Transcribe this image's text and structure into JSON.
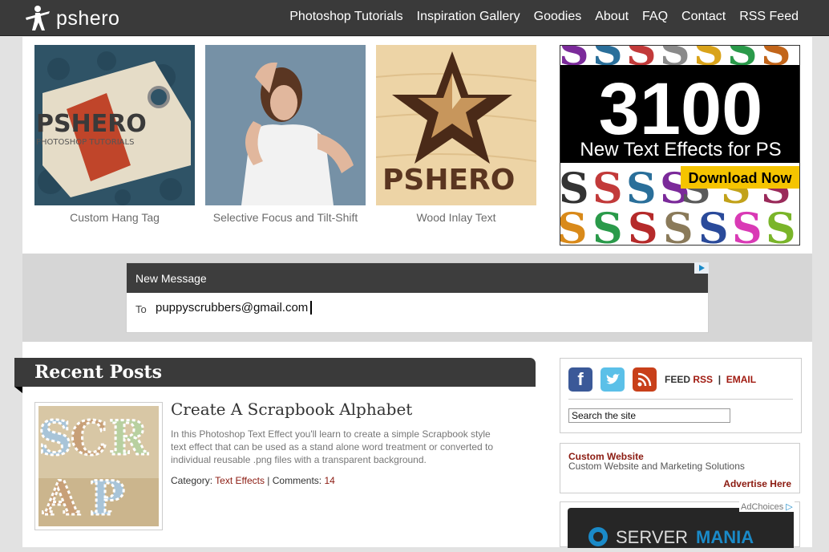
{
  "header": {
    "logo_text": "pshero",
    "nav": [
      "Photoshop Tutorials",
      "Inspiration Gallery",
      "Goodies",
      "About",
      "FAQ",
      "Contact",
      "RSS Feed"
    ]
  },
  "featured": [
    {
      "caption": "Custom Hang Tag",
      "art_text": "PSHERO",
      "art_sub": "PHOTOSHOP TUTORIALS"
    },
    {
      "caption": "Selective Focus and Tilt-Shift"
    },
    {
      "caption": "Wood Inlay Text",
      "art_text": "PSHERO"
    }
  ],
  "ad_right": {
    "big_number": "3100",
    "subline": "New Text Effects for PS",
    "cta": "Download Now"
  },
  "message": {
    "header": "New Message",
    "to_label": "To",
    "to_value": "puppyscrubbers@gmail.com"
  },
  "recent": {
    "heading": "Recent Posts",
    "post": {
      "title": "Create A Scrapbook Alphabet",
      "excerpt": "In this Photoshop Text Effect you'll learn to create a simple Scrapbook style text effect that can be used as a stand alone word treatment or converted to individual reusable .png files with a transparent background.",
      "category_label": "Category:",
      "category": "Text Effects",
      "comments_label": "Comments:",
      "comments": "14",
      "separator": " | ",
      "art_text": "SCRAP"
    }
  },
  "sidebar": {
    "feed_label": "FEED",
    "rss_label": "RSS",
    "divider": "|",
    "email_label": "EMAIL",
    "search_value": "Search the site",
    "custom_title": "Custom Website",
    "custom_desc": "Custom Website and Marketing Solutions",
    "advertise": "Advertise Here",
    "adchoices": "AdChoices",
    "server_ad_text": "SERVER",
    "server_ad_text2": "MANIA"
  },
  "colors": {
    "topbar": "#3a3a3a",
    "link_red": "#8b1a10",
    "ad_yellow": "#f5c400"
  }
}
